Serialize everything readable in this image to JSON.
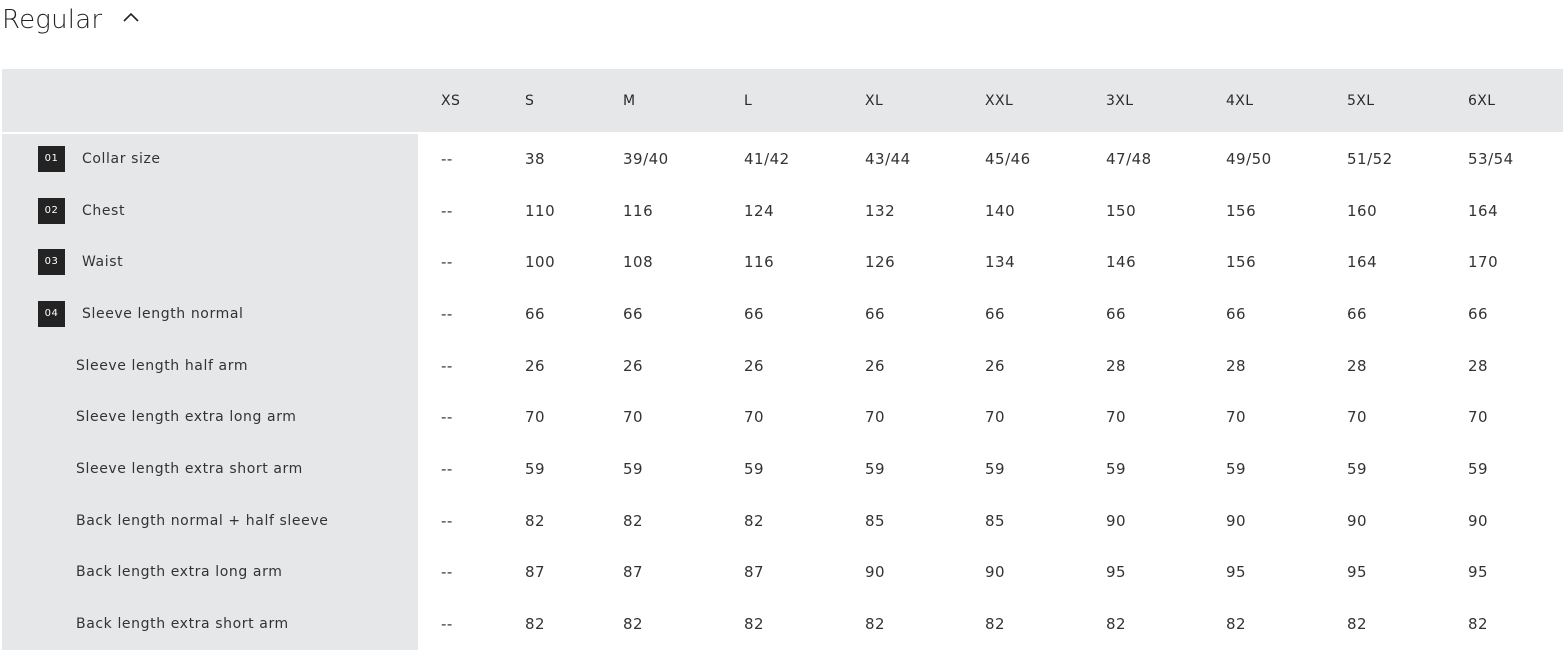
{
  "section": {
    "title": "Regular",
    "toggle_icon": "chevron-up-icon"
  },
  "table": {
    "columns": [
      "XS",
      "S",
      "M",
      "L",
      "XL",
      "XXL",
      "3XL",
      "4XL",
      "5XL",
      "6XL"
    ],
    "rows": [
      {
        "badge": "01",
        "label": "Collar size",
        "values": [
          "--",
          "38",
          "39/40",
          "41/42",
          "43/44",
          "45/46",
          "47/48",
          "49/50",
          "51/52",
          "53/54"
        ]
      },
      {
        "badge": "02",
        "label": "Chest",
        "values": [
          "--",
          "110",
          "116",
          "124",
          "132",
          "140",
          "150",
          "156",
          "160",
          "164"
        ]
      },
      {
        "badge": "03",
        "label": "Waist",
        "values": [
          "--",
          "100",
          "108",
          "116",
          "126",
          "134",
          "146",
          "156",
          "164",
          "170"
        ]
      },
      {
        "badge": "04",
        "label": "Sleeve length normal",
        "values": [
          "--",
          "66",
          "66",
          "66",
          "66",
          "66",
          "66",
          "66",
          "66",
          "66"
        ]
      },
      {
        "badge": "",
        "label": "Sleeve length half arm",
        "values": [
          "--",
          "26",
          "26",
          "26",
          "26",
          "26",
          "28",
          "28",
          "28",
          "28"
        ]
      },
      {
        "badge": "",
        "label": "Sleeve length extra long arm",
        "values": [
          "--",
          "70",
          "70",
          "70",
          "70",
          "70",
          "70",
          "70",
          "70",
          "70"
        ]
      },
      {
        "badge": "",
        "label": "Sleeve length extra short arm",
        "values": [
          "--",
          "59",
          "59",
          "59",
          "59",
          "59",
          "59",
          "59",
          "59",
          "59"
        ]
      },
      {
        "badge": "",
        "label": "Back length normal + half sleeve",
        "values": [
          "--",
          "82",
          "82",
          "82",
          "85",
          "85",
          "90",
          "90",
          "90",
          "90"
        ]
      },
      {
        "badge": "",
        "label": "Back length extra long arm",
        "values": [
          "--",
          "87",
          "87",
          "87",
          "90",
          "90",
          "95",
          "95",
          "95",
          "95"
        ]
      },
      {
        "badge": "",
        "label": "Back length extra short arm",
        "values": [
          "--",
          "82",
          "82",
          "82",
          "82",
          "82",
          "82",
          "82",
          "82",
          "82"
        ]
      }
    ]
  }
}
